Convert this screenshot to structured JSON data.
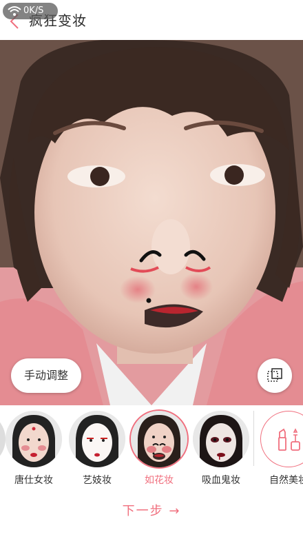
{
  "status": {
    "network_speed": "0K/S"
  },
  "header": {
    "title": "疯狂变妆"
  },
  "photo": {
    "manual_adjust_label": "手动调整"
  },
  "styles": [
    {
      "label": "唐仕女妆",
      "selected": false
    },
    {
      "label": "艺妓妆",
      "selected": false
    },
    {
      "label": "如花妆",
      "selected": true
    },
    {
      "label": "吸血鬼妆",
      "selected": false
    },
    {
      "label": "自然美妆",
      "selected": false
    }
  ],
  "footer": {
    "next_label": "下一步 →"
  },
  "colors": {
    "accent": "#f06f7e"
  }
}
